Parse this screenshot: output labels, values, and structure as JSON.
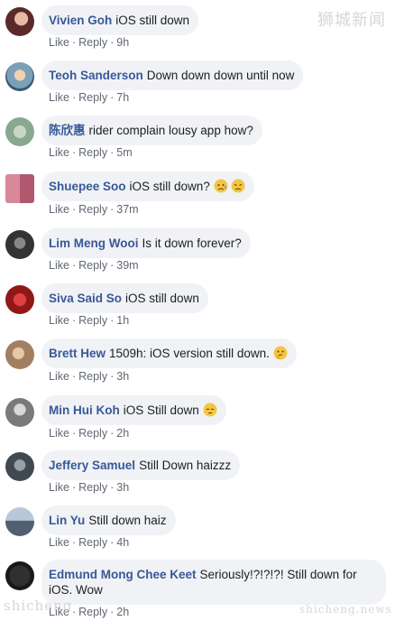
{
  "watermark_top": "狮城新闻",
  "watermark_bottom_left": "shicheng",
  "watermark_bottom_right": "shicheng.news",
  "action_labels": {
    "like": "Like",
    "reply": "Reply",
    "dot": "·"
  },
  "comments": [
    {
      "name": "Vivien Goh",
      "text": "iOS still down",
      "time": "9h"
    },
    {
      "name": "Teoh Sanderson",
      "text": "Down down down until now",
      "time": "7h"
    },
    {
      "name": "陈欣惠",
      "text": "rider complain lousy app how?",
      "time": "5m"
    },
    {
      "name": "Shuepee Soo",
      "text": "iOS still down?",
      "time": "37m",
      "emojis": [
        "disappointed-relieved-emoji",
        "disappointed-face-emoji"
      ]
    },
    {
      "name": "Lim Meng Wooi",
      "text": "Is it down forever?",
      "time": "39m"
    },
    {
      "name": "Siva Said So",
      "text": "iOS still down",
      "time": "1h"
    },
    {
      "name": "Brett Hew",
      "text": "1509h: iOS version still down.",
      "time": "3h",
      "emojis": [
        "thinking-face-emoji"
      ]
    },
    {
      "name": "Min Hui Koh",
      "text": "iOS Still down",
      "time": "2h",
      "emojis": [
        "pensive-face-emoji"
      ]
    },
    {
      "name": "Jeffery Samuel",
      "text": "Still Down haizzz",
      "time": "3h"
    },
    {
      "name": "Lin Yu",
      "text": "Still down haiz",
      "time": "4h"
    },
    {
      "name": "Edmund Mong Chee Keet",
      "text": "Seriously!?!?!?! Still down for iOS. Wow",
      "time": "2h"
    }
  ],
  "colors": {
    "name": "#385898",
    "bubble": "#f0f2f5",
    "meta": "#606770",
    "text": "#1c1e21"
  }
}
